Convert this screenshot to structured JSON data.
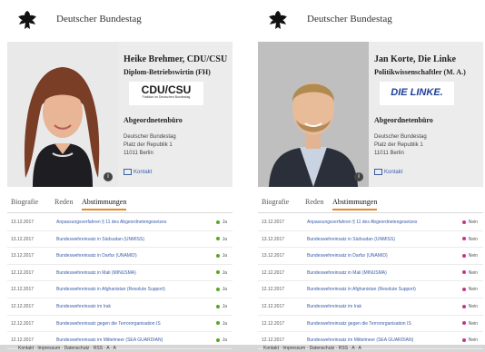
{
  "colors": {
    "accent": "#e38a2c",
    "link": "#3a5da8",
    "vote_yes": "#5aa52a",
    "vote_no": "#c8338a"
  },
  "panels": [
    {
      "site_title": "Deutscher Bundestag",
      "name": "Heike Brehmer, CDU/CSU",
      "profession": "Diplom-Betriebswirtin (FH)",
      "party_logo": {
        "text": "CDU/CSU",
        "sub": "Fraktion im Deutschen Bundestag",
        "color": "#1a1a1a",
        "accent": "#e41e26"
      },
      "office_title": "Abgeordnetenbüro",
      "address": [
        "Deutscher Bundestag",
        "Platz der Republik 1",
        "11011 Berlin"
      ],
      "contact": "Kontakt",
      "info_icon": "i",
      "tabs": [
        "Biografie",
        "Reden",
        "Abstimmungen"
      ],
      "active_tab": 2,
      "votes": [
        {
          "date": "13.12.2017",
          "topic": "Anpassungsverfahren § 11 des Abgeordnetengesetzes",
          "vote": "Ja"
        },
        {
          "date": "13.12.2017",
          "topic": "Bundeswehreinsatz in Südsudan (UNMISS)",
          "vote": "Ja"
        },
        {
          "date": "13.12.2017",
          "topic": "Bundeswehreinsatz in Darfur (UNAMID)",
          "vote": "Ja"
        },
        {
          "date": "12.12.2017",
          "topic": "Bundeswehreinsatz in Mali (MINUSMA)",
          "vote": "Ja"
        },
        {
          "date": "12.12.2017",
          "topic": "Bundeswehreinsatz in Afghanistan (Resolute Support)",
          "vote": "Ja"
        },
        {
          "date": "12.12.2017",
          "topic": "Bundeswehreinsatz im Irak",
          "vote": "Ja"
        },
        {
          "date": "12.12.2017",
          "topic": "Bundeswehreinsatz gegen die Terrororganisation IS",
          "vote": "Ja"
        },
        {
          "date": "12.12.2017",
          "topic": "Bundeswehreinsatz im Mittelmeer (SEA GUARDIAN)",
          "vote": "Ja"
        }
      ],
      "footer": "Kontakt · Impressum · Datenschutz · RSS · A · A"
    },
    {
      "site_title": "Deutscher Bundestag",
      "name": "Jan Korte, Die Linke",
      "profession": "Politikwissenschaftler (M. A.)",
      "party_logo": {
        "text": "DIE LINKE.",
        "sub": "",
        "color": "#1f3f9a",
        "accent": "#e41e26"
      },
      "office_title": "Abgeordnetenbüro",
      "address": [
        "Deutscher Bundestag",
        "Platz der Republik 1",
        "11011 Berlin"
      ],
      "contact": "Kontakt",
      "info_icon": "i",
      "tabs": [
        "Biografie",
        "Reden",
        "Abstimmungen"
      ],
      "active_tab": 2,
      "votes": [
        {
          "date": "13.12.2017",
          "topic": "Anpassungsverfahren § 11 des Abgeordnetengesetzes",
          "vote": "Nein"
        },
        {
          "date": "13.12.2017",
          "topic": "Bundeswehreinsatz in Südsudan (UNMISS)",
          "vote": "Nein"
        },
        {
          "date": "13.12.2017",
          "topic": "Bundeswehreinsatz in Darfur (UNAMID)",
          "vote": "Nein"
        },
        {
          "date": "12.12.2017",
          "topic": "Bundeswehreinsatz in Mali (MINUSMA)",
          "vote": "Nein"
        },
        {
          "date": "12.12.2017",
          "topic": "Bundeswehreinsatz in Afghanistan (Resolute Support)",
          "vote": "Nein"
        },
        {
          "date": "12.12.2017",
          "topic": "Bundeswehreinsatz im Irak",
          "vote": "Nein"
        },
        {
          "date": "12.12.2017",
          "topic": "Bundeswehreinsatz gegen die Terrororganisation IS",
          "vote": "Nein"
        },
        {
          "date": "12.12.2017",
          "topic": "Bundeswehreinsatz im Mittelmeer (SEA GUARDIAN)",
          "vote": "Nein"
        }
      ],
      "footer": "Kontakt · Impressum · Datenschutz · RSS · A · A"
    }
  ]
}
